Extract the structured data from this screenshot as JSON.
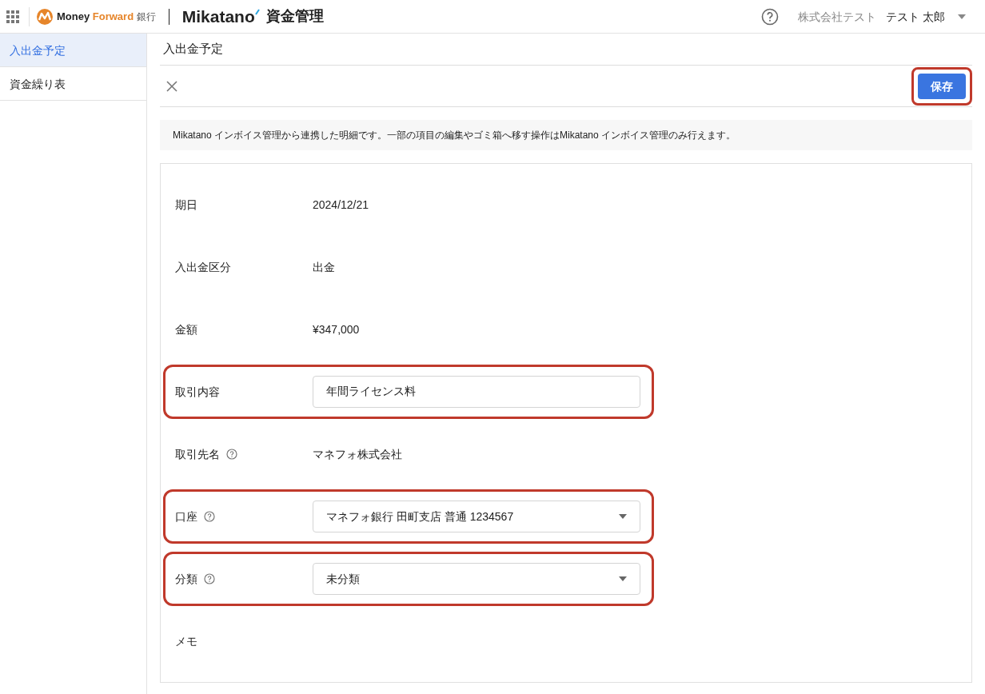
{
  "header": {
    "brand_a": "Money",
    "brand_b": "Forward",
    "brand_suffix": "銀行",
    "product": "Mikatano",
    "product_suffix": "資金管理",
    "company": "株式会社テスト",
    "user": "テスト 太郎"
  },
  "sidebar": {
    "items": [
      {
        "label": "入出金予定",
        "selected": true
      },
      {
        "label": "資金繰り表",
        "selected": false
      }
    ]
  },
  "page_title": "入出金予定",
  "toolbar": {
    "save": "保存",
    "save_highlighted": true
  },
  "notice": "Mikatano インボイス管理から連携した明細です。一部の項目の編集やゴミ箱へ移す操作はMikatano インボイス管理のみ行えます。",
  "fields": [
    {
      "label": "期日",
      "kind": "text",
      "value": "2024/12/21",
      "help": false,
      "highlighted": false
    },
    {
      "label": "入出金区分",
      "kind": "text",
      "value": "出金",
      "help": false,
      "highlighted": false
    },
    {
      "label": "金額",
      "kind": "text",
      "value": "¥347,000",
      "help": false,
      "highlighted": false
    },
    {
      "label": "取引内容",
      "kind": "input",
      "value": "年間ライセンス料",
      "help": false,
      "highlighted": true
    },
    {
      "label": "取引先名",
      "kind": "text",
      "value": "マネフォ株式会社",
      "help": true,
      "highlighted": false
    },
    {
      "label": "口座",
      "kind": "select",
      "value": "マネフォ銀行 田町支店 普通 1234567",
      "help": true,
      "highlighted": true
    },
    {
      "label": "分類",
      "kind": "select",
      "value": "未分類",
      "help": true,
      "highlighted": true
    },
    {
      "label": "メモ",
      "kind": "text",
      "help": false,
      "highlighted": false
    }
  ]
}
